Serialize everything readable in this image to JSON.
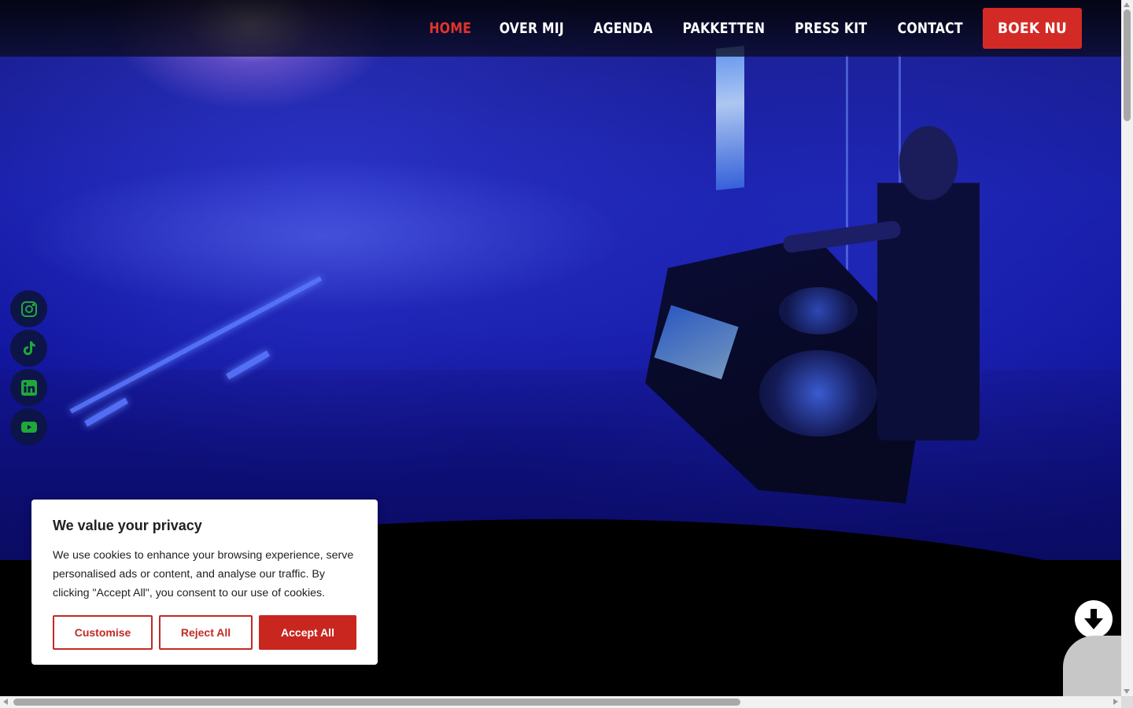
{
  "nav": {
    "items": [
      {
        "label": "HOME",
        "active": true
      },
      {
        "label": "OVER MIJ"
      },
      {
        "label": "AGENDA"
      },
      {
        "label": "PAKKETTEN"
      },
      {
        "label": "PRESS KIT"
      },
      {
        "label": "CONTACT"
      }
    ],
    "cta_label": "BOEK NU"
  },
  "social": {
    "icons": [
      "instagram-icon",
      "tiktok-icon",
      "linkedin-icon",
      "youtube-icon"
    ],
    "icon_color": "#1fa83a"
  },
  "cookie": {
    "title": "We value your privacy",
    "body": "We use cookies to enhance your browsing experience, serve personalised ads or content, and analyse our traffic. By clicking \"Accept All\", you consent to our use of cookies.",
    "customise_label": "Customise",
    "reject_label": "Reject All",
    "accept_label": "Accept All"
  },
  "colors": {
    "accent": "#d42a26",
    "nav_active": "#e0342c"
  },
  "icons": {
    "scroll_down": "arrow-down-icon"
  }
}
